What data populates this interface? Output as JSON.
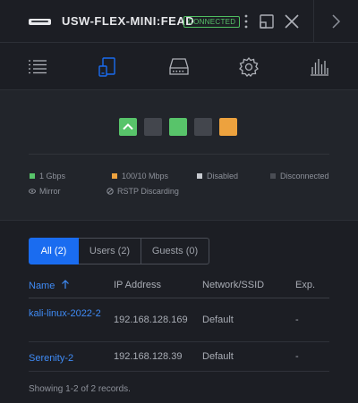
{
  "header": {
    "device_name": "USW-FLEX-MINI:FEAD",
    "status_badge": "CONNECTED",
    "icons": [
      "switch-device-icon",
      "more-vertical-icon",
      "popout-icon",
      "close-icon",
      "chevron-right-icon"
    ]
  },
  "tabs": [
    {
      "name": "overview",
      "icon": "list-icon",
      "active": false
    },
    {
      "name": "devices",
      "icon": "devices-icon",
      "active": true
    },
    {
      "name": "ports",
      "icon": "switch-ports-icon",
      "active": false
    },
    {
      "name": "settings",
      "icon": "gear-icon",
      "active": false
    },
    {
      "name": "statistics",
      "icon": "bar-chart-icon",
      "active": false
    }
  ],
  "ports": [
    {
      "state": "connected-1g",
      "uplink": true,
      "color": "#58c46a"
    },
    {
      "state": "disconnected",
      "uplink": false,
      "color": "#43464d"
    },
    {
      "state": "connected-1g",
      "uplink": false,
      "color": "#58c46a"
    },
    {
      "state": "disconnected",
      "uplink": false,
      "color": "#43464d"
    },
    {
      "state": "connected-100-10",
      "uplink": false,
      "color": "#eda23e"
    }
  ],
  "legend": {
    "gbps": "1 Gbps",
    "mbps": "100/10 Mbps",
    "disabled": "Disabled",
    "disconnected": "Disconnected",
    "mirror": "Mirror",
    "rstp": "RSTP Discarding"
  },
  "colors": {
    "accent": "#1a6cf0",
    "link": "#3f8bf5",
    "gbps": "#58c46a",
    "mbps": "#eda23e",
    "disabled": "#c8cbd1",
    "disconnected": "#4a4d54"
  },
  "filters": [
    {
      "label": "All (2)",
      "active": true
    },
    {
      "label": "Users (2)",
      "active": false
    },
    {
      "label": "Guests (0)",
      "active": false
    }
  ],
  "table": {
    "columns": {
      "name": "Name",
      "ip": "IP Address",
      "network": "Network/SSID",
      "exp": "Exp."
    },
    "rows": [
      {
        "name": "kali-linux-2022-2",
        "ip": "192.168.128.169",
        "network": "Default",
        "exp": "-"
      },
      {
        "name": "Serenity-2",
        "ip": "192.168.128.39",
        "network": "Default",
        "exp": "-"
      }
    ]
  },
  "footer": {
    "records_text": "Showing 1-2 of 2 records."
  }
}
